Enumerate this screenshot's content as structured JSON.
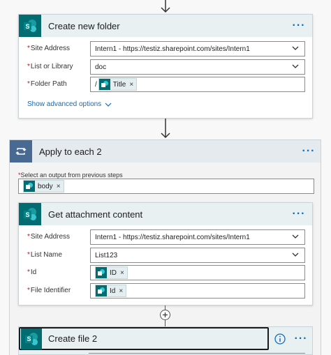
{
  "create_folder": {
    "title": "Create new folder",
    "more": "···",
    "site_label": "Site Address",
    "site_value": "Intern1 - https://testiz.sharepoint.com/sites/Intern1",
    "list_label": "List or Library",
    "list_value": "doc",
    "path_label": "Folder Path",
    "path_prefix": "/",
    "path_token": "Title",
    "advanced": "Show advanced options"
  },
  "apply_each": {
    "title": "Apply to each 2",
    "more": "···",
    "select_label": "Select an output from previous steps",
    "select_token": "body"
  },
  "get_attachment": {
    "title": "Get attachment content",
    "more": "···",
    "site_label": "Site Address",
    "site_value": "Intern1 - https://testiz.sharepoint.com/sites/Intern1",
    "list_label": "List Name",
    "list_value": "List123",
    "id_label": "Id",
    "id_token": "ID",
    "file_label": "File Identifier",
    "file_token": "Id"
  },
  "create_file": {
    "title": "Create file 2",
    "more": "···",
    "info_icon": "info-icon"
  },
  "token_close": "×",
  "required_mark": "*",
  "colors": {
    "sharepoint": "#036c70",
    "header_bg": "#e9f0f2",
    "accent": "#0f6cbd",
    "loop_header": "#e5eaef"
  }
}
